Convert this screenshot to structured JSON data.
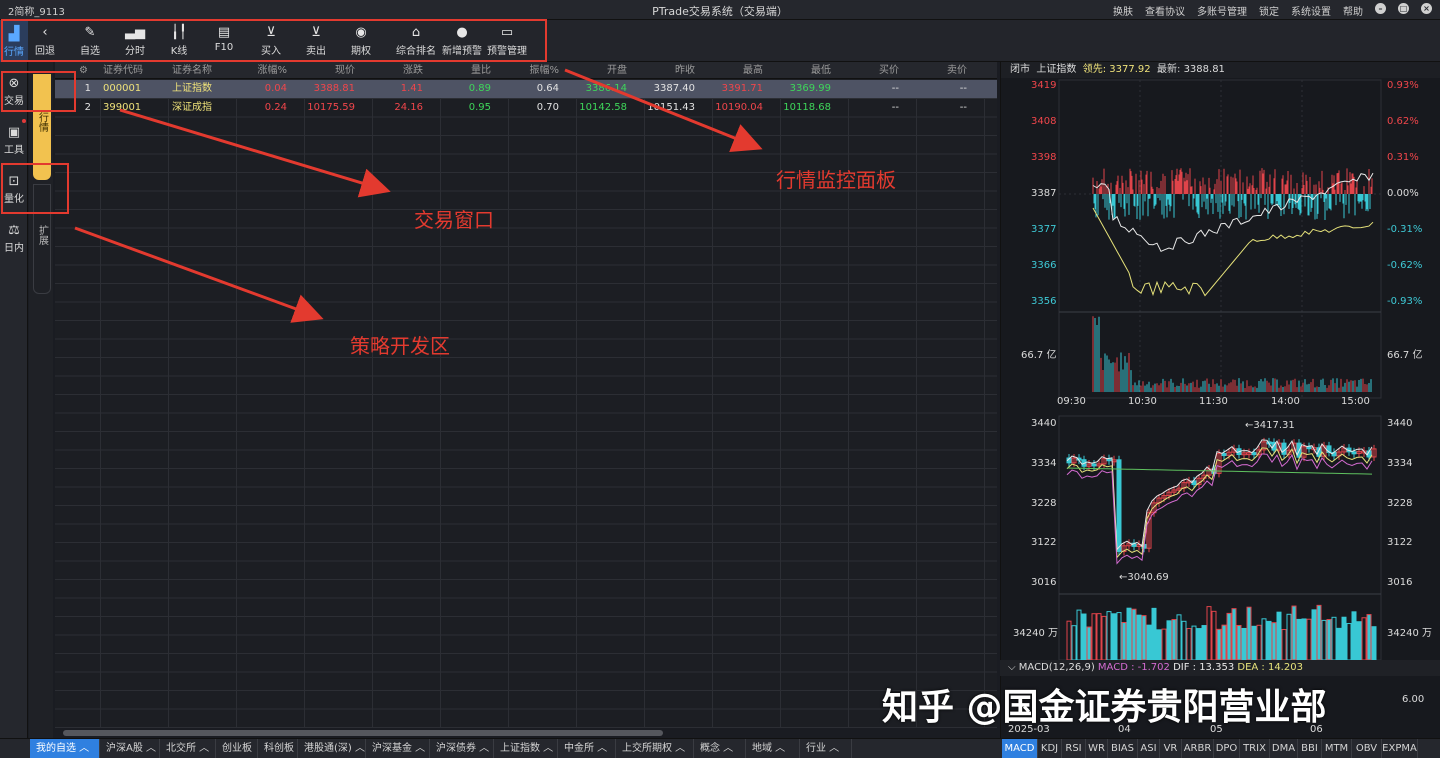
{
  "titlebar": {
    "user": "2简称_9113",
    "title": "PTrade交易系统（交易端）",
    "right_items": [
      "换肤",
      "查看协议",
      "多账号管理",
      "锁定",
      "系统设置",
      "帮助"
    ]
  },
  "toolbar": {
    "active": "行情",
    "items": [
      "回退",
      "自选",
      "分时",
      "K线",
      "F10",
      "买入",
      "卖出",
      "期权",
      "综合排名",
      "新增预警",
      "预警管理"
    ]
  },
  "sidebar": {
    "items": [
      "交易",
      "工具",
      "量化",
      "日内"
    ]
  },
  "subtabs": {
    "quotes": "行情",
    "extend": "扩展"
  },
  "table": {
    "headers": [
      "证券代码",
      "证券名称",
      "涨幅%",
      "现价",
      "涨跌",
      "量比",
      "振幅%",
      "开盘",
      "昨收",
      "最高",
      "最低",
      "买价",
      "卖价"
    ],
    "rows": [
      [
        "1",
        "000001",
        "上证指数",
        "0.04",
        "3388.81",
        "1.41",
        "0.89",
        "0.64",
        "3386.14",
        "3387.40",
        "3391.71",
        "3369.99",
        "--",
        "--"
      ],
      [
        "2",
        "399001",
        "深证成指",
        "0.24",
        "10175.59",
        "24.16",
        "0.95",
        "0.70",
        "10142.58",
        "10151.43",
        "10190.04",
        "10118.68",
        "--",
        "--"
      ]
    ]
  },
  "bottom_tabs": [
    "我的自选",
    "沪深A股",
    "北交所",
    "创业板",
    "科创板",
    "港股通(深)",
    "沪深基金",
    "沪深债券",
    "上证指数",
    "中金所",
    "上交所期权",
    "概念",
    "地域",
    "行业"
  ],
  "chart_panel": {
    "header": {
      "status": "闭市",
      "name": "上证指数",
      "lead_label": "领先",
      "lead_value": "3377.92",
      "latest_label": "最新",
      "latest_value": "3388.81"
    },
    "intraday_left_labels": [
      "3419",
      "3408",
      "3398",
      "3387",
      "3377",
      "3366",
      "3356"
    ],
    "intraday_right_labels": [
      "0.93%",
      "0.62%",
      "0.31%",
      "0.00%",
      "-0.31%",
      "-0.62%",
      "-0.93%"
    ],
    "volume_label": "66.7 亿",
    "time_labels": [
      "09:30",
      "10:30",
      "11:30",
      "14:00",
      "15:00"
    ],
    "kline_labels": [
      "3440",
      "3334",
      "3228",
      "3122",
      "3016"
    ],
    "kline_high": "←3417.31",
    "kline_low": "←3040.69",
    "kline_volume_label": "34240 万",
    "macd": {
      "name": "MACD(12,26,9)",
      "macd_label": "MACD : -1.702",
      "dif_label": "DIF : 13.353",
      "dea_label": "DEA : 14.203"
    },
    "date_labels": [
      "2025-03",
      "04",
      "05",
      "06"
    ],
    "macd_right_label": "6.00",
    "indicator_tabs": [
      "MACD",
      "KDJ",
      "RSI",
      "WR",
      "BIAS",
      "ASI",
      "VR",
      "ARBR",
      "DPO",
      "TRIX",
      "DMA",
      "BBI",
      "MTM",
      "OBV",
      "EXPMA"
    ]
  },
  "annotations": {
    "trade_window": "交易窗口",
    "monitor_panel": "行情监控面板",
    "strategy_area": "策略开发区"
  },
  "watermark": "知乎 @国金证券贵阳营业部",
  "colors": {
    "up": "#f0464b",
    "down": "#3ed65a",
    "annotation": "#e33a2f",
    "active_tab": "#2f80e0",
    "subtab_yellow": "#f2c24f"
  }
}
